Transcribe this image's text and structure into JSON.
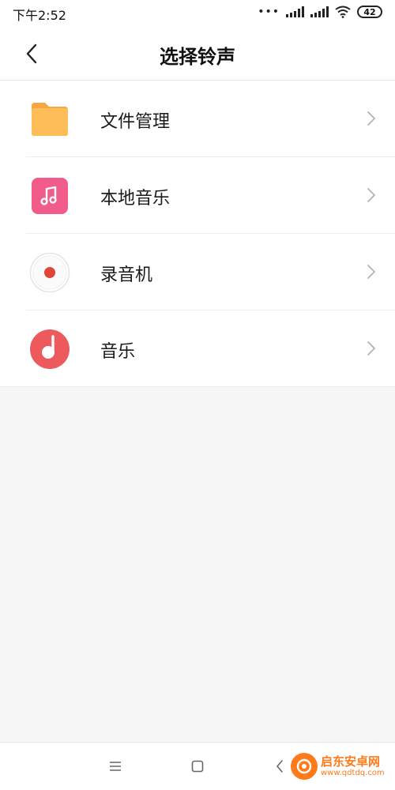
{
  "status_bar": {
    "time": "下午2:52",
    "battery": "42"
  },
  "header": {
    "title": "选择铃声"
  },
  "list": {
    "items": [
      {
        "label": "文件管理",
        "icon": "folder-icon"
      },
      {
        "label": "本地音乐",
        "icon": "music-note-icon"
      },
      {
        "label": "录音机",
        "icon": "record-icon"
      },
      {
        "label": "音乐",
        "icon": "music-app-icon"
      }
    ]
  },
  "colors": {
    "folder": "#ffb74d",
    "music_note_bg": "#f25c8a",
    "record_dot": "#e0453a",
    "music_app": "#ec5a5e",
    "watermark": "#ff7a1a"
  },
  "watermark": {
    "name": "启东安卓网",
    "url": "www.qdtdq.com"
  }
}
